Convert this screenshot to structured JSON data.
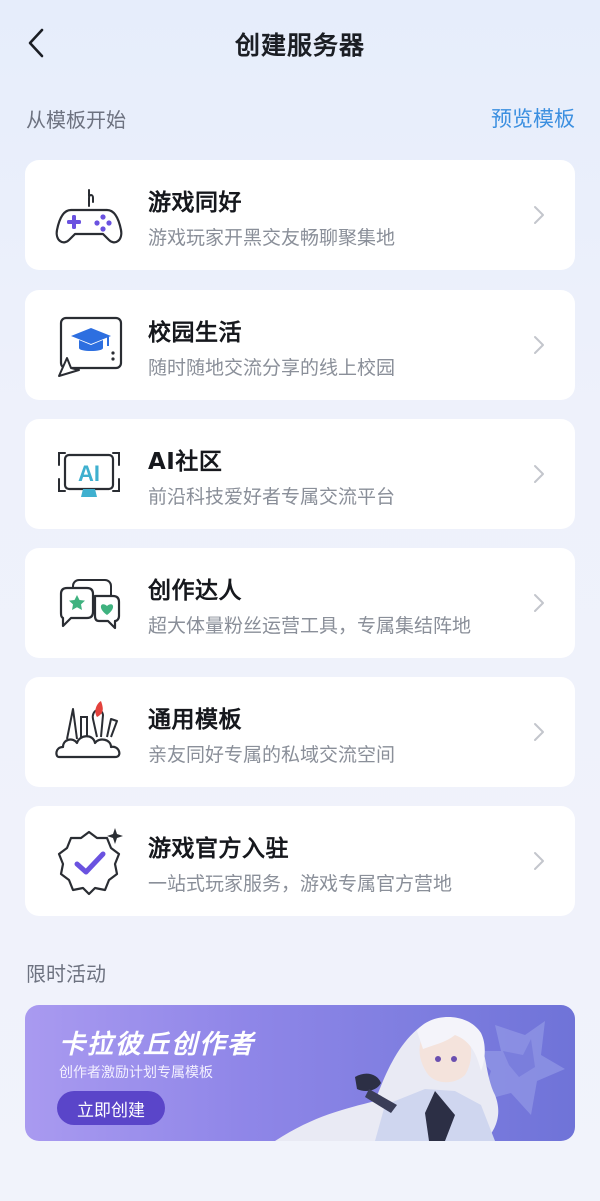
{
  "header": {
    "title": "创建服务器"
  },
  "templates_section": {
    "label": "从模板开始",
    "preview_link": "预览模板",
    "items": [
      {
        "title": "游戏同好",
        "desc": "游戏玩家开黑交友畅聊聚集地",
        "icon": "gamepad-icon"
      },
      {
        "title": "校园生活",
        "desc": "随时随地交流分享的线上校园",
        "icon": "graduation-cap-icon"
      },
      {
        "title": "AI社区",
        "desc": "前沿科技爱好者专属交流平台",
        "icon": "ai-monitor-icon"
      },
      {
        "title": "创作达人",
        "desc": "超大体量粉丝运营工具，专属集结阵地",
        "icon": "chat-bubbles-icon"
      },
      {
        "title": "通用模板",
        "desc": "亲友同好专属的私域交流空间",
        "icon": "paintbrush-cloud-icon"
      },
      {
        "title": "游戏官方入驻",
        "desc": "一站式玩家服务，游戏专属官方营地",
        "icon": "verified-badge-icon"
      }
    ]
  },
  "activity_section": {
    "label": "限时活动",
    "banner": {
      "title": "卡拉彼丘创作者",
      "subtitle": "创作者激励计划专属模板",
      "button": "立即创建"
    }
  },
  "colors": {
    "accent_blue": "#3b8fe0",
    "icon_purple": "#6a52e0",
    "icon_green": "#3fb27f",
    "icon_blue": "#2d6fe0",
    "icon_red": "#e3413c",
    "banner_button": "#5a45c9"
  }
}
